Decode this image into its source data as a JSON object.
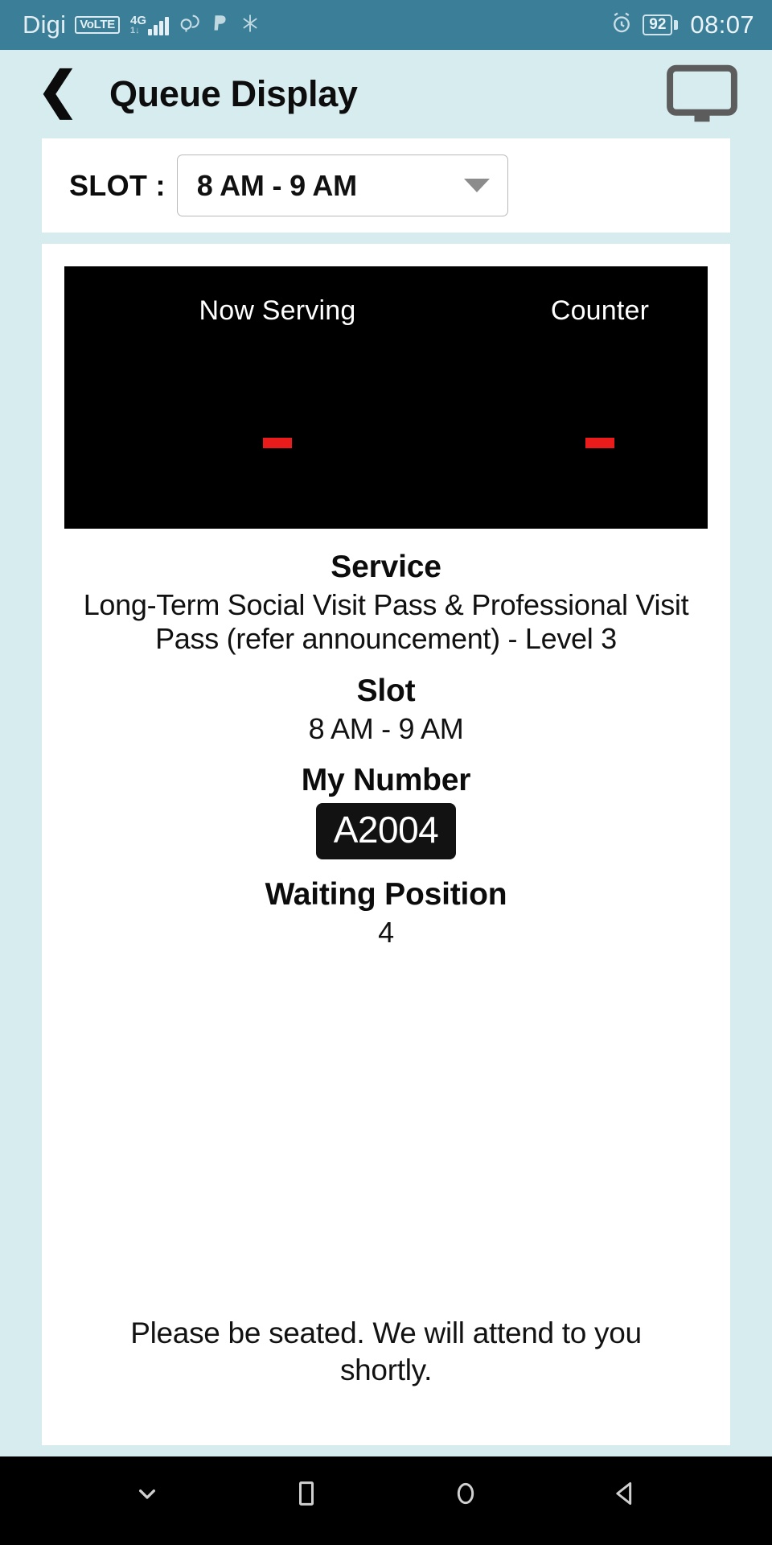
{
  "status_bar": {
    "carrier": "Digi",
    "volte_badge": "VoLTE",
    "network_type": "4G",
    "network_sub": "1↓",
    "icons": [
      "signal-bars-icon",
      "weather-icon",
      "paypal-icon",
      "sparkle-icon",
      "alarm-icon"
    ],
    "battery_percent": "92",
    "time": "08:07",
    "background_color": "#3b7e97"
  },
  "header": {
    "back_label": "❮",
    "title": "Queue Display",
    "display_icon": "monitor-icon"
  },
  "slot_bar": {
    "label": "SLOT :",
    "selected_value": "8 AM - 9 AM",
    "options": [
      "8 AM - 9 AM"
    ]
  },
  "board": {
    "columns": [
      "Now Serving",
      "Counter"
    ],
    "values": [
      "-",
      "-"
    ],
    "value_color": "#ea1b1b",
    "background_color": "#000000"
  },
  "details": {
    "service_heading": "Service",
    "service_value": "Long-Term Social Visit Pass & Professional Visit Pass (refer announcement) - Level 3",
    "slot_heading": "Slot",
    "slot_value": "8 AM - 9 AM",
    "my_number_heading": "My Number",
    "my_number_value": "A2004",
    "waiting_position_heading": "Waiting Position",
    "waiting_position_value": "4"
  },
  "footer": {
    "message": "Please be seated. We will attend to you shortly."
  },
  "nav_bar": {
    "buttons": [
      "hide-keyboard-icon",
      "recents-icon",
      "home-icon",
      "back-icon"
    ]
  }
}
